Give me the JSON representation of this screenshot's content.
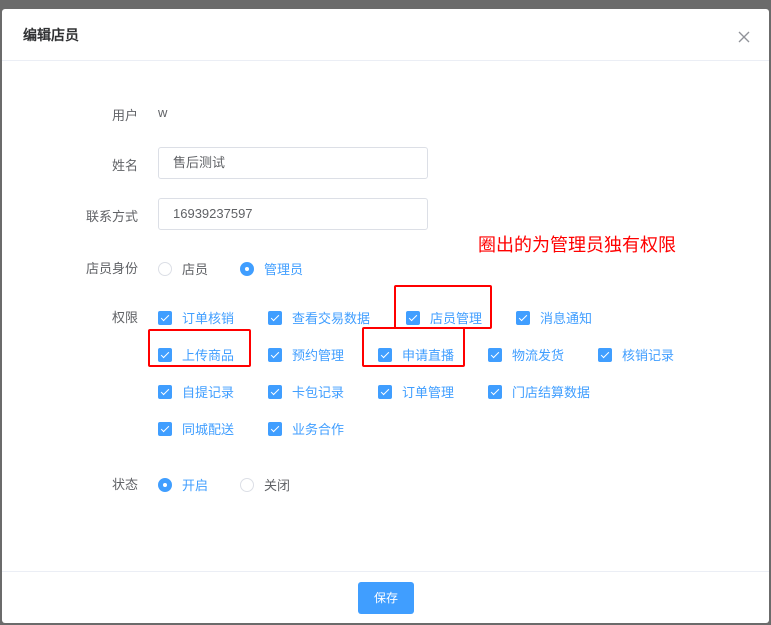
{
  "dialog": {
    "title": "编辑店员",
    "close_icon": "close-icon"
  },
  "form": {
    "user": {
      "label": "用户",
      "value": "w"
    },
    "name": {
      "label": "姓名",
      "value": "售后测试"
    },
    "contact": {
      "label": "联系方式",
      "value": "16939237597"
    },
    "identity": {
      "label": "店员身份",
      "options": [
        {
          "label": "店员",
          "checked": false
        },
        {
          "label": "管理员",
          "checked": true
        }
      ]
    },
    "permissions": {
      "label": "权限",
      "items": [
        {
          "label": "订单核销",
          "checked": true
        },
        {
          "label": "查看交易数据",
          "checked": true
        },
        {
          "label": "店员管理",
          "checked": true,
          "highlighted": true
        },
        {
          "label": "消息通知",
          "checked": true
        },
        {
          "label": "上传商品",
          "checked": true,
          "highlighted": true
        },
        {
          "label": "预约管理",
          "checked": true
        },
        {
          "label": "申请直播",
          "checked": true,
          "highlighted": true
        },
        {
          "label": "物流发货",
          "checked": true
        },
        {
          "label": "核销记录",
          "checked": true
        },
        {
          "label": "自提记录",
          "checked": true
        },
        {
          "label": "卡包记录",
          "checked": true
        },
        {
          "label": "订单管理",
          "checked": true
        },
        {
          "label": "门店结算数据",
          "checked": true
        },
        {
          "label": "同城配送",
          "checked": true
        },
        {
          "label": "业务合作",
          "checked": true
        }
      ]
    },
    "status": {
      "label": "状态",
      "options": [
        {
          "label": "开启",
          "checked": true
        },
        {
          "label": "关闭",
          "checked": false
        }
      ]
    }
  },
  "annotation": {
    "text": "圈出的为管理员独有权限",
    "color": "#ff0000"
  },
  "footer": {
    "save_label": "保存"
  },
  "colors": {
    "accent": "#409eff",
    "text": "#606266",
    "highlight": "#ff0000"
  }
}
